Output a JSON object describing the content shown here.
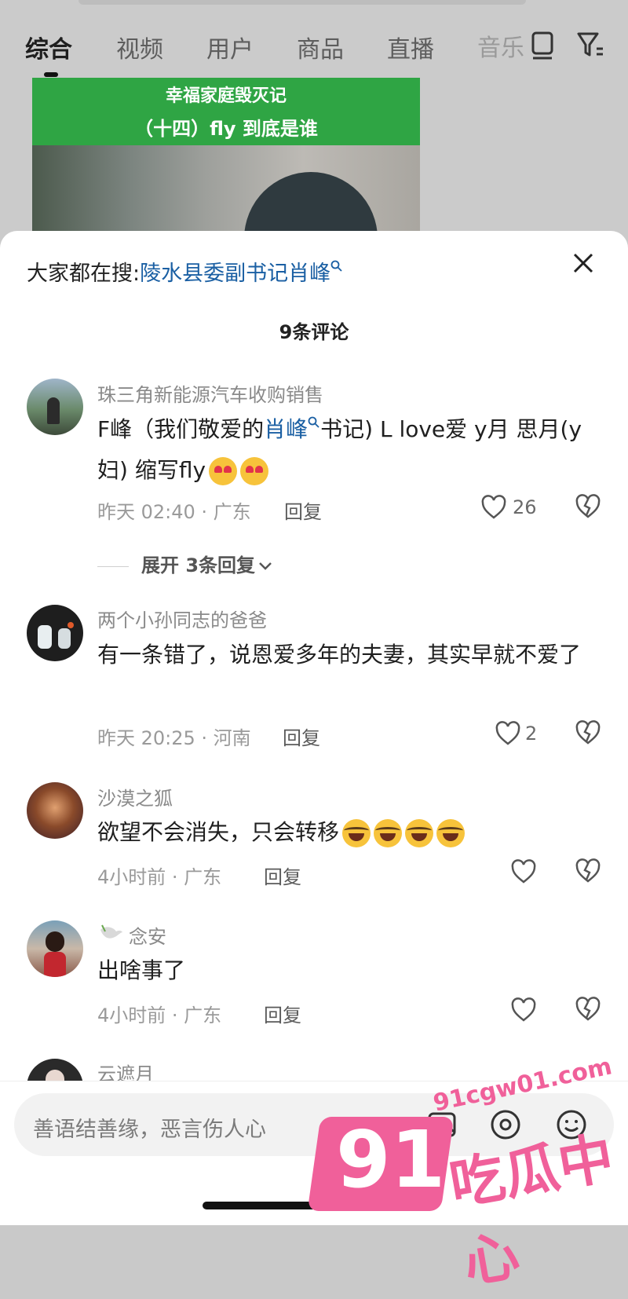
{
  "tabs": [
    "综合",
    "视频",
    "用户",
    "商品",
    "直播"
  ],
  "tab_overflow": "音乐",
  "video": {
    "line1": "幸福家庭毁灭记",
    "line2": "（十四）fly 到底是谁"
  },
  "hot_search": {
    "prefix": "大家都在搜:",
    "keyword": "陵水县委副书记肖峰"
  },
  "comment_count": "9条评论",
  "comments": [
    {
      "user": "珠三角新能源汽车收购销售",
      "text_before": "F峰（我们敬爱的",
      "keyword": "肖峰",
      "text_after": "书记) L love爱 y月 思月(y妇) 缩写fly",
      "emojis": [
        "heart-eyes-emoji",
        "heart-eyes-emoji"
      ],
      "time": "昨天 02:40 · 广东",
      "reply": "回复",
      "likes": "26",
      "expand": "展开 3条回复"
    },
    {
      "user": "两个小孙同志的爸爸",
      "text": "有一条错了，说恩爱多年的夫妻，其实早就不爱了",
      "time": "昨天 20:25 · 河南",
      "reply": "回复",
      "likes": "2"
    },
    {
      "user": "沙漠之狐",
      "text": "欲望不会消失，只会转移",
      "emojis": [
        "laugh-cry-emoji",
        "laugh-cry-emoji",
        "laugh-cry-emoji",
        "laugh-cry-emoji"
      ],
      "time": "4小时前 · 广东",
      "reply": "回复"
    },
    {
      "user": "念安",
      "text": "出啥事了",
      "time": "4小时前 · 广东",
      "reply": "回复"
    },
    {
      "user": "云遮月"
    }
  ],
  "input_placeholder": "善语结善缘，恶言伤人心",
  "watermark": {
    "url": "91cgw01.com",
    "num": "91",
    "cn": "吃瓜中心"
  },
  "colors": {
    "keyword": "#1a5fa3",
    "watermark": "#f0609a",
    "video_banner": "#2fa544"
  }
}
